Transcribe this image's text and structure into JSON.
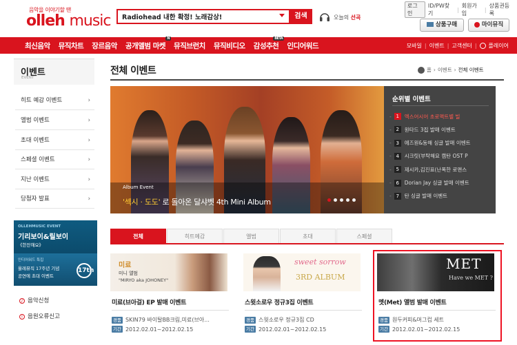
{
  "header": {
    "tagline": "음악을 이야기할 땐",
    "logo_brand": "olleh",
    "logo_music": "music",
    "search_value": "Radiohead 내한 확정! 노래감상!",
    "search_button": "검색",
    "today_prefix": "오늘의",
    "today_highlight": "선곡",
    "top_links": [
      "로그인",
      "ID/PW찾기",
      "회원가입",
      "상품권등록"
    ],
    "buy_button": "상품구매",
    "mymusic_button": "마이뮤직"
  },
  "nav": {
    "items": [
      "최신음악",
      "뮤직차트",
      "장르음악",
      "공개앨범 마켓",
      "뮤직브런치",
      "뮤직비디오",
      "감성추천",
      "인디어워드"
    ],
    "badges": {
      "3": "N",
      "6": "BETA"
    },
    "right": [
      "모바일",
      "이벤트",
      "고객센터",
      "플레이어"
    ]
  },
  "sidebar": {
    "title": "이벤트",
    "subtitle": "EVENT",
    "items": [
      "히트 예감 이벤트",
      "앨범 이벤트",
      "초대 이벤트",
      "스페셜 이벤트",
      "지난 이벤트",
      "당첨자 발표"
    ],
    "banner": {
      "top": "OLLEHMUSIC EVENT",
      "title": "기리보이&릴보이",
      "subtitle": "《한잔해요》",
      "b_top": "인디어워드 특집",
      "b_line1": "올레뮤직 17주년 기념",
      "b_line2": "공연에 초대 이벤트",
      "b_badge": "17th"
    },
    "links": [
      "음악신청",
      "음원오류신고"
    ]
  },
  "main": {
    "title": "전체 이벤트",
    "breadcrumb": [
      "홈",
      "이벤트",
      "전체 이벤트"
    ],
    "hero": {
      "event_label": "Album Event",
      "caption_hl": "'섹시 · 도도'",
      "caption_rest": " 로 돌아온 달샤벳 4th Mini Album",
      "dots": 5,
      "active_dot": 0
    },
    "ranking": {
      "title": "순위별 이벤트",
      "active": 0,
      "items": [
        "엑스어시어 초로맥트별 빌",
        "원타드 3집 발매 이벤트",
        "에즈원&동해 싱글 발매 이벤트",
        "시크릿(부탁해요 캠탄 OST P",
        "제시카,김진표(난폭한 로맨스",
        "Dorian Jay 싱글 발매 이벤트",
        "탄 싱글 발매 이벤트"
      ]
    },
    "tabs": [
      "전체",
      "히트예감",
      "앨범",
      "초대",
      "스페셜"
    ],
    "active_tab": 0,
    "cards": [
      {
        "img_line1": "미료",
        "img_line2": "미니 앨범",
        "img_line3": "\"MIRYO aka JOHONEY\"",
        "title": "미료(브아걸) EP 발매 이벤트",
        "gift_label": "경품",
        "gift": "SKIN79 바이탈BB크림,미료(브아...",
        "period_label": "기간",
        "period": "2012.02.01~2012.02.15"
      },
      {
        "img_line1": "sweet sorrow",
        "img_line2": "3RD ALBUM",
        "title": "스윗소로우 정규3집 이벤트",
        "gift_label": "경품",
        "gift": "스윗소로우 정규3집 CD",
        "period_label": "기간",
        "period": "2012.02.01~2012.02.15"
      },
      {
        "img_line1": "MET",
        "img_line2": "Have we MET ?",
        "title": "멧(Met) 앨범 발매 이벤트",
        "gift_label": "경품",
        "gift": "원두커피&머그컵 세트",
        "period_label": "기간",
        "period": "2012.02.01~2012.02.15"
      }
    ]
  }
}
